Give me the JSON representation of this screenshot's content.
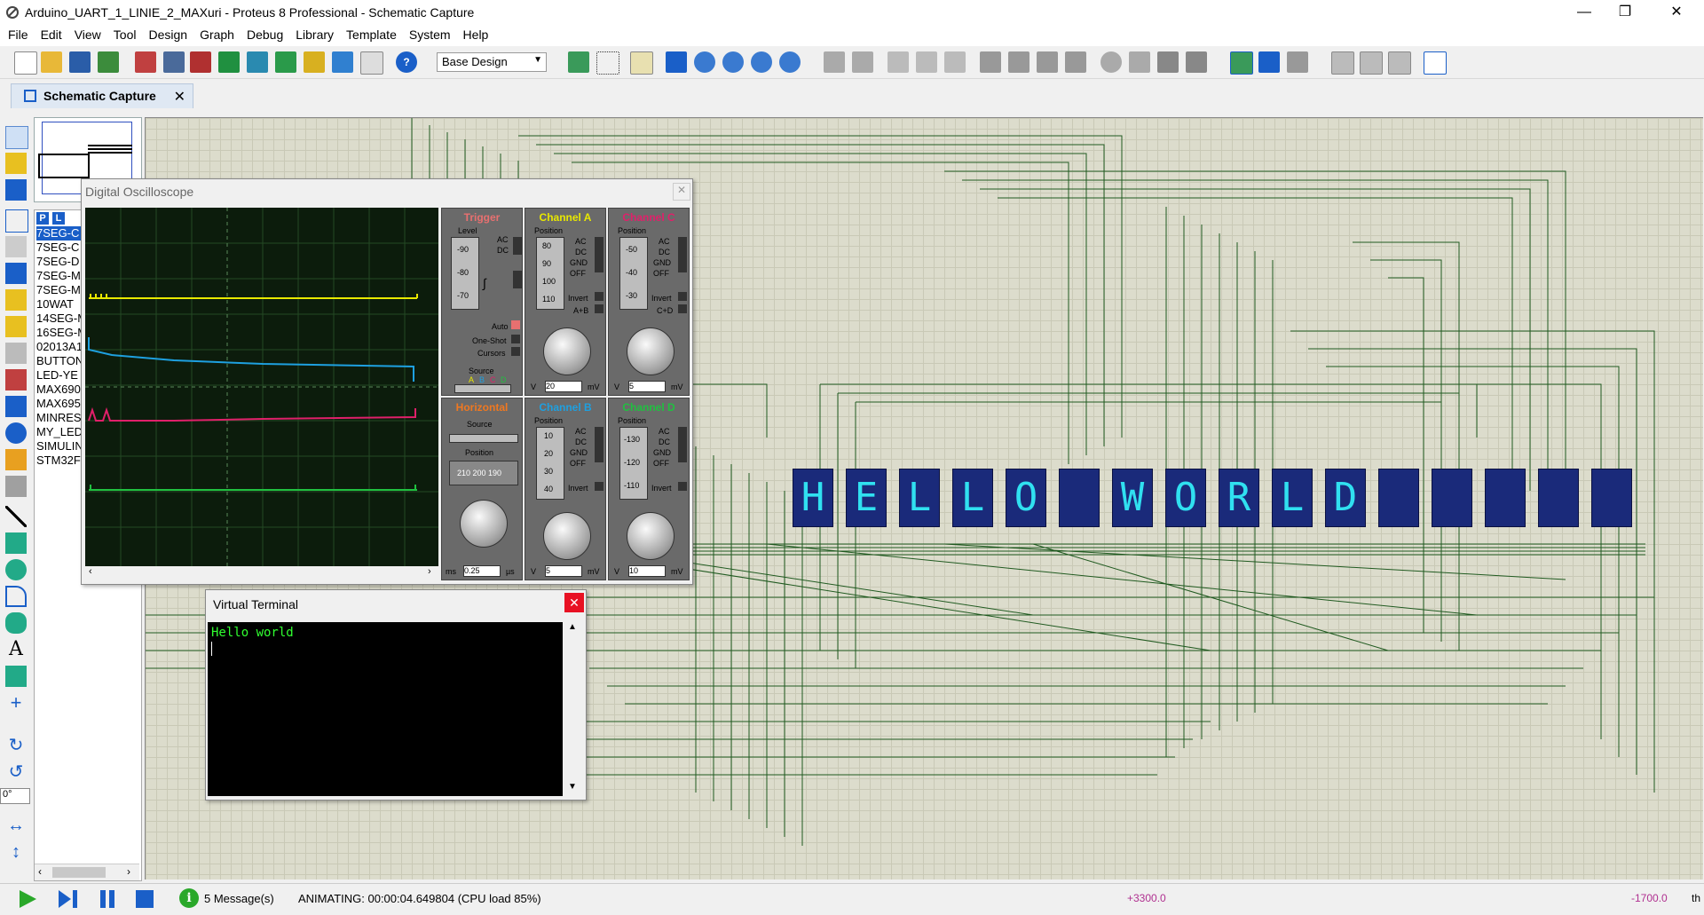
{
  "window": {
    "title": "Arduino_UART_1_LINIE_2_MAXuri - Proteus 8 Professional - Schematic Capture"
  },
  "menu": [
    "File",
    "Edit",
    "View",
    "Tool",
    "Design",
    "Graph",
    "Debug",
    "Library",
    "Template",
    "System",
    "Help"
  ],
  "toolbar": {
    "design_select": "Base Design"
  },
  "tab": {
    "label": "Schematic Capture"
  },
  "device_panel": {
    "p_button": "P",
    "l_button": "L",
    "items": [
      "7SEG-C",
      "7SEG-C",
      "7SEG-D",
      "7SEG-M",
      "7SEG-M",
      "10WAT",
      "14SEG-M",
      "16SEG-M",
      "02013A1",
      "BUTTON",
      "LED-YE",
      "MAX690",
      "MAX695",
      "MINRES",
      "MY_LED",
      "SIMULIN",
      "STM32F"
    ]
  },
  "rotation": {
    "value": "0°"
  },
  "oscilloscope": {
    "title": "Digital Oscilloscope",
    "trigger": {
      "title": "Trigger",
      "level_label": "Level",
      "ac": "AC",
      "dc": "DC",
      "auto": "Auto",
      "one_shot": "One-Shot",
      "cursors": "Cursors",
      "source": "Source",
      "source_letters": [
        "A",
        "B",
        "C",
        "D"
      ],
      "scale": [
        "-90",
        "-80",
        "-70"
      ]
    },
    "channel_a": {
      "title": "Channel A",
      "position": "Position",
      "scale": [
        "80",
        "90",
        "100",
        "110"
      ],
      "modes": [
        "AC",
        "DC",
        "GND",
        "OFF"
      ],
      "invert": "Invert",
      "sum": "A+B",
      "value": "20",
      "unit_left": "V",
      "unit_right": "mV"
    },
    "channel_b": {
      "title": "Channel B",
      "position": "Position",
      "scale": [
        "10",
        "20",
        "30",
        "40"
      ],
      "modes": [
        "AC",
        "DC",
        "GND",
        "OFF"
      ],
      "invert": "Invert",
      "value": "5",
      "unit_left": "V",
      "unit_right": "mV"
    },
    "channel_c": {
      "title": "Channel C",
      "position": "Position",
      "scale": [
        "-50",
        "-40",
        "-30"
      ],
      "modes": [
        "AC",
        "DC",
        "GND",
        "OFF"
      ],
      "invert": "Invert",
      "sum": "C+D",
      "value": "5",
      "unit_left": "V",
      "unit_right": "mV"
    },
    "channel_d": {
      "title": "Channel D",
      "position": "Position",
      "scale": [
        "-130",
        "-120",
        "-110"
      ],
      "modes": [
        "AC",
        "DC",
        "GND",
        "OFF"
      ],
      "invert": "Invert",
      "value": "10",
      "unit_left": "V",
      "unit_right": "mV"
    },
    "horizontal": {
      "title": "Horizontal",
      "source": "Source",
      "position": "Position",
      "display": "210 200 190",
      "value": "0.25",
      "unit_left": "ms",
      "unit_right": "µs"
    }
  },
  "terminal": {
    "title": "Virtual Terminal",
    "text": "Hello world"
  },
  "display": {
    "chars": [
      "H",
      "E",
      "L",
      "L",
      "O",
      " ",
      "W",
      "O",
      "R",
      "L",
      "D",
      " ",
      " ",
      " ",
      " ",
      " "
    ]
  },
  "status": {
    "messages": "5 Message(s)",
    "animating": "ANIMATING: 00:00:04.649804 (CPU load 85%)",
    "x": "+3300.0",
    "y": "-1700.0",
    "unit": "th"
  },
  "colors": {
    "channel_a": "#e8e800",
    "channel_b": "#1ea0e0",
    "channel_c": "#e0206a",
    "channel_d": "#20c040",
    "trigger": "#e87070",
    "horizontal": "#f07820"
  }
}
